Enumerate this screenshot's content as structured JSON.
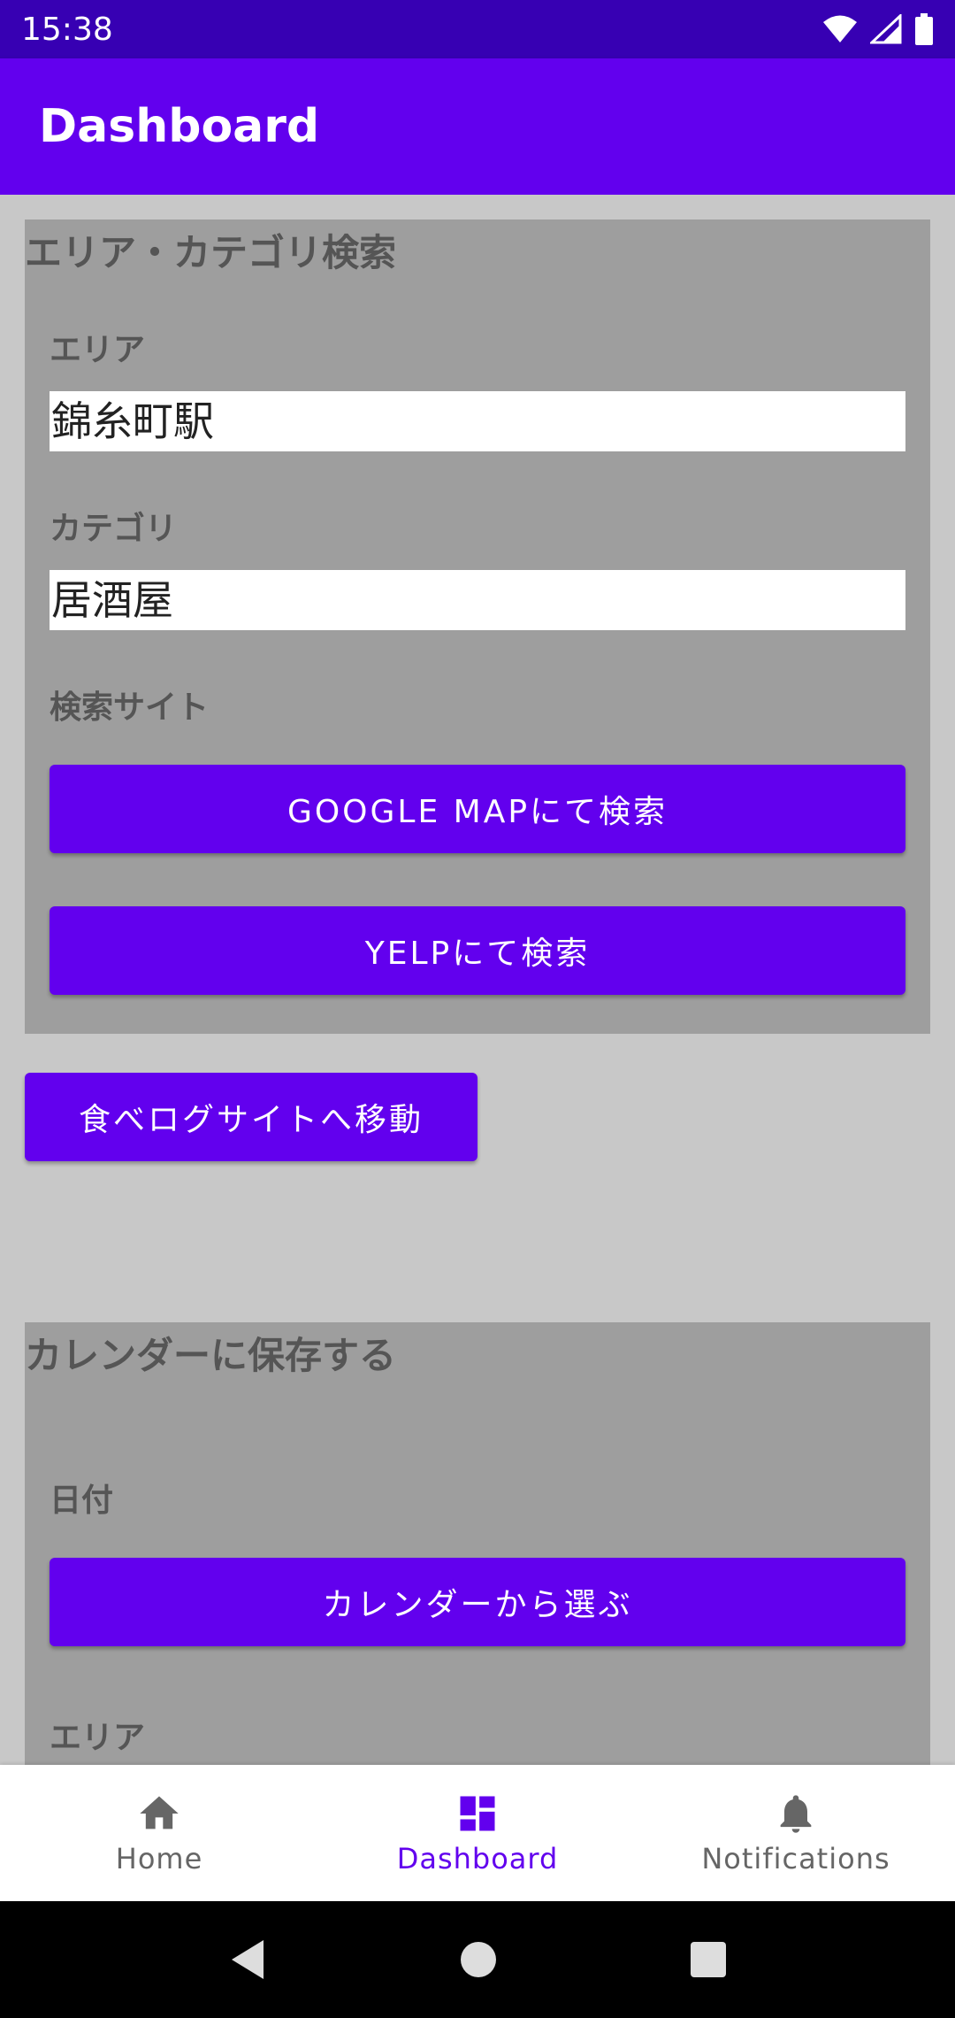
{
  "status_bar": {
    "time": "15:38",
    "icons": [
      "wifi-icon",
      "cell-signal-icon",
      "battery-icon"
    ]
  },
  "app_bar": {
    "title": "Dashboard"
  },
  "search_panel": {
    "title": "エリア・カテゴリ検索",
    "area_label": "エリア",
    "area_value": "錦糸町駅",
    "category_label": "カテゴリ",
    "category_value": "居酒屋",
    "site_label": "検索サイト",
    "google_button": "GOOGLE MAPにて検索",
    "yelp_button": "YELPにて検索"
  },
  "tabelog_button": "食べログサイトへ移動",
  "calendar_panel": {
    "title": "カレンダーに保存する",
    "date_label": "日付",
    "pick_button": "カレンダーから選ぶ",
    "area_label": "エリア"
  },
  "bottom_nav": {
    "items": [
      {
        "label": "Home",
        "icon": "home-icon",
        "active": false
      },
      {
        "label": "Dashboard",
        "icon": "dashboard-icon",
        "active": true
      },
      {
        "label": "Notifications",
        "icon": "bell-icon",
        "active": false
      }
    ]
  },
  "colors": {
    "status_bar": "#3700b3",
    "app_bar": "#6200ee",
    "accent": "#6200ee",
    "panel": "#9e9e9e",
    "background": "#c8c8c8"
  }
}
